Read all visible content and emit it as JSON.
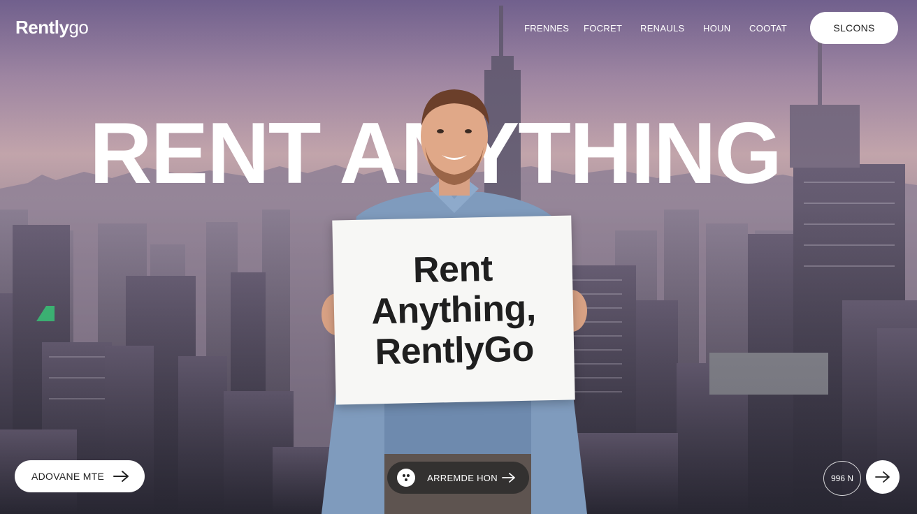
{
  "header": {
    "logo_main": "Rently",
    "logo_go": "go",
    "nav": [
      "FRENNES",
      "FOCRET",
      "RENAULS",
      "HOUN",
      "COOTAT"
    ],
    "cta_label": "SLCONS"
  },
  "hero": {
    "headline": "RENT ANYTHING",
    "sign_lines": [
      "Rent",
      "Anything,",
      "RentlyGo"
    ]
  },
  "bottom": {
    "left_button_label": "ADOVANE MTE",
    "mid_button_label": "ARREMDE HON",
    "badge_text": "996 N"
  },
  "icons": {
    "arrow": "arrow-right-icon",
    "mid_icon": "dots-icon"
  },
  "colors": {
    "accent": "#ffffff",
    "dark_button": "#2a2a2a"
  }
}
